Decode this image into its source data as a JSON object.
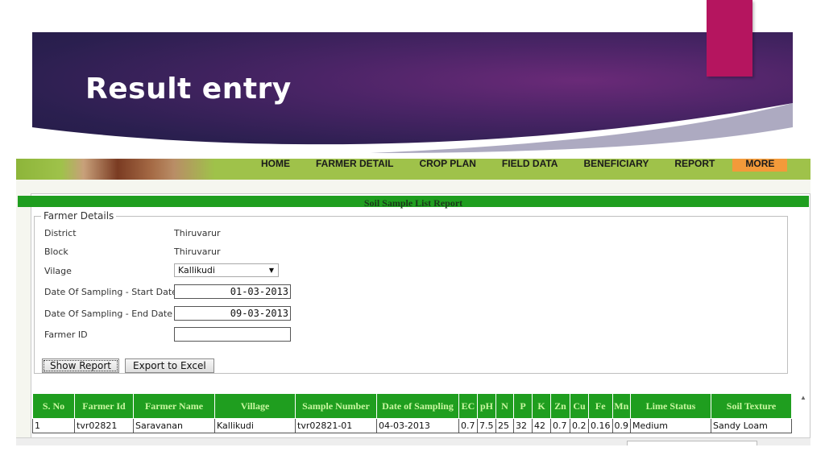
{
  "slide": {
    "title": "Result entry",
    "accent_color": "#b5155f"
  },
  "nav": {
    "items": [
      "HOME",
      "FARMER DETAIL",
      "CROP PLAN",
      "FIELD DATA",
      "BENEFICIARY",
      "REPORT"
    ],
    "more": "MORE",
    "more_color": "#f39a3a"
  },
  "report": {
    "title": "Soil Sample List Report",
    "bar_color": "#1f9e1f"
  },
  "farmer_details": {
    "legend": "Farmer Details",
    "district_label": "District",
    "district_value": "Thiruvarur",
    "block_label": "Block",
    "block_value": "Thiruvarur",
    "village_label": "Vilage",
    "village_value": "Kallikudi",
    "start_label": "Date Of Sampling - Start Date",
    "start_value": "01-03-2013",
    "end_label": "Date Of Sampling - End Date",
    "end_value": "09-03-2013",
    "farmer_id_label": "Farmer ID",
    "farmer_id_value": ""
  },
  "buttons": {
    "show_report": "Show Report",
    "export": "Export to Excel"
  },
  "table": {
    "headers": [
      "S. No",
      "Farmer Id",
      "Farmer Name",
      "Village",
      "Sample Number",
      "Date of Sampling",
      "EC",
      "pH",
      "N",
      "P",
      "K",
      "Zn",
      "Cu",
      "Fe",
      "Mn",
      "Lime Status",
      "Soil Texture"
    ],
    "rows": [
      [
        "1",
        "tvr02821",
        "Saravanan",
        "Kallikudi",
        "tvr02821-01",
        "04-03-2013",
        "0.7",
        "7.5",
        "25",
        "32",
        "42",
        "0.7",
        "0.2",
        "0.16",
        "0.9",
        "Medium",
        "Sandy Loam"
      ]
    ]
  }
}
